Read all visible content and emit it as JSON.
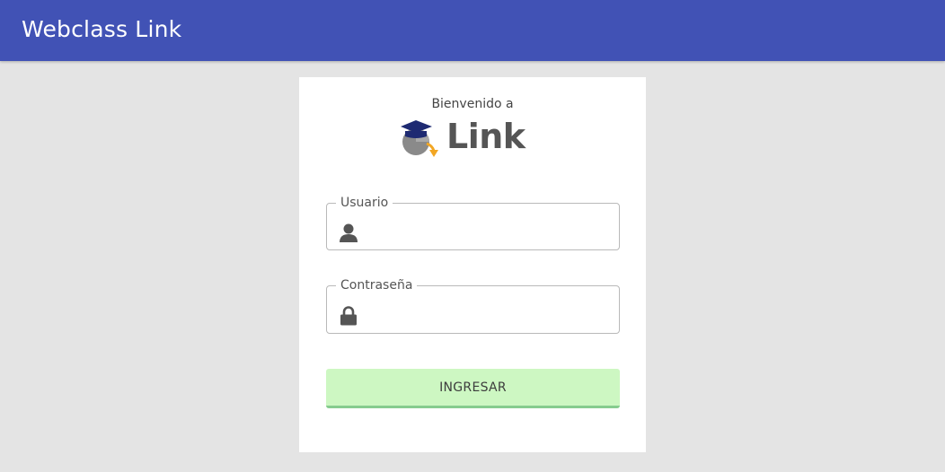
{
  "header": {
    "title": "Webclass Link",
    "color": "#4152b5"
  },
  "login": {
    "welcome": "Bienvenido a",
    "logo_text": "Link",
    "username": {
      "label": "Usuario",
      "value": "",
      "icon": "user-icon"
    },
    "password": {
      "label": "Contraseña",
      "value": "",
      "icon": "lock-icon"
    },
    "submit_label": "INGRESAR",
    "submit_color": "#cdf7c2"
  }
}
